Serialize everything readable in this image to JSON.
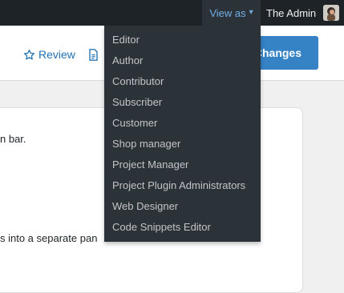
{
  "admin_bar": {
    "view_as_label": "View as",
    "view_as_caret": "▾",
    "account_name": "The Admin"
  },
  "toolbar": {
    "review_label": "Review",
    "save_label": "Changes"
  },
  "content": {
    "line1": "n bar.",
    "line2": "s into a separate pan"
  },
  "view_as_menu": {
    "items": [
      {
        "label": "Editor"
      },
      {
        "label": "Author"
      },
      {
        "label": "Contributor"
      },
      {
        "label": "Subscriber"
      },
      {
        "label": "Customer"
      },
      {
        "label": "Shop manager"
      },
      {
        "label": "Project Manager"
      },
      {
        "label": "Project Plugin Administrators"
      },
      {
        "label": "Web Designer"
      },
      {
        "label": "Code Snippets Editor"
      }
    ]
  },
  "colors": {
    "admin_bar_bg": "#1d2327",
    "menu_bg": "#2c3338",
    "link": "#2271b1",
    "primary_button": "#3582c4"
  },
  "icons": {
    "review": "star-outline-icon",
    "document": "document-icon",
    "caret": "caret-down-icon"
  }
}
